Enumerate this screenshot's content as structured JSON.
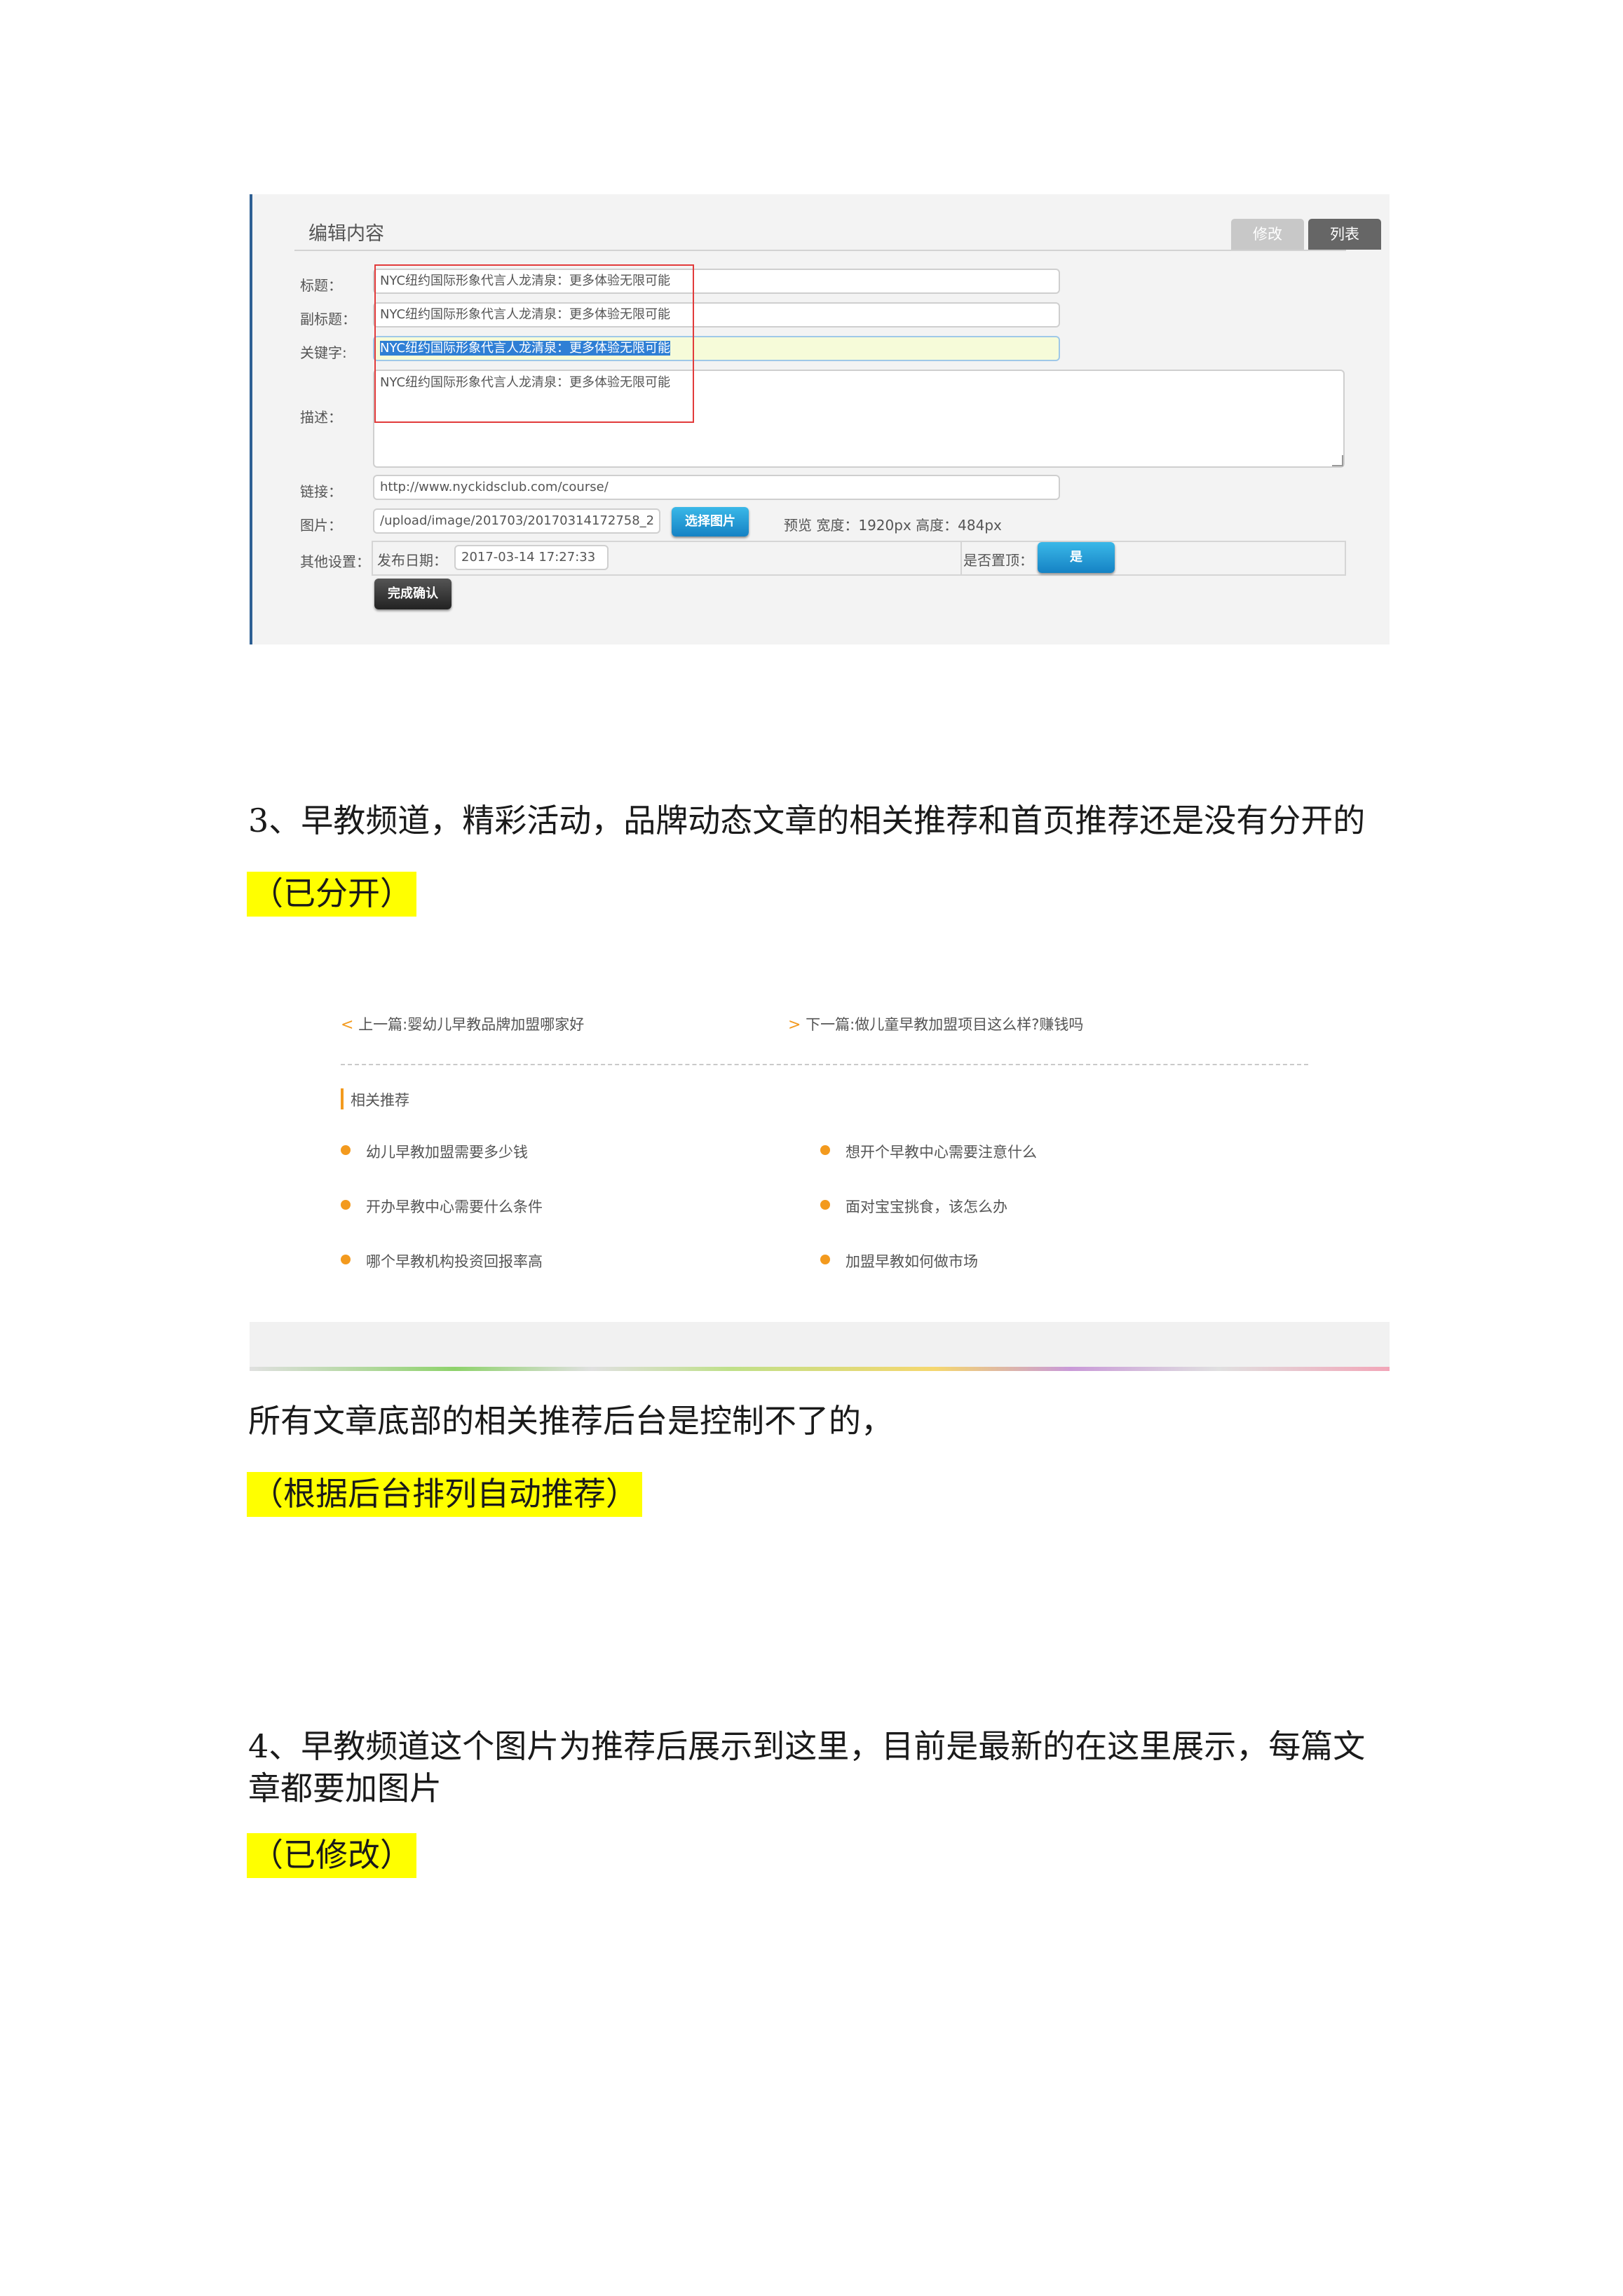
{
  "edit_form": {
    "title": "编辑内容",
    "tab_edit": "修改",
    "tab_list": "列表",
    "labels": {
      "title": "标题：",
      "subtitle": "副标题：",
      "keywords": "关键字:",
      "description": "描述：",
      "link": "链接：",
      "image": "图片：",
      "other": "其他设置：",
      "publish_date": "发布日期：",
      "pin_top": "是否置顶："
    },
    "values": {
      "title": "NYC纽约国际形象代言人龙清泉：更多体验无限可能",
      "subtitle": "NYC纽约国际形象代言人龙清泉：更多体验无限可能",
      "keywords": "NYC纽约国际形象代言人龙清泉：更多体验无限可能",
      "description": "NYC纽约国际形象代言人龙清泉：更多体验无限可能",
      "link": "http://www.nyckidsclub.com/course/",
      "image": "/upload/image/201703/20170314172758_2",
      "publish_date": "2017-03-14 17:27:33"
    },
    "choose_image_button": "选择图片",
    "preview_text": "预览 宽度：1920px 高度：484px",
    "pin_top_button": "是",
    "confirm_button": "完成确认"
  },
  "doc": {
    "item3": "3、早教频道，精彩活动，品牌动态文章的相关推荐和首页推荐还是没有分开的",
    "item3_status": "（已分开）",
    "note": "所有文章底部的相关推荐后台是控制不了的，",
    "note_status": "（根据后台排列自动推荐）",
    "item4_line1": "4、早教频道这个图片为推荐后展示到这里，目前是最新的在这里展示，每篇文",
    "item4_line2": "章都要加图片",
    "item4_status": "（已修改）"
  },
  "related": {
    "prev_chevron": "<",
    "prev": "上一篇:婴幼儿早教品牌加盟哪家好",
    "next_chevron": ">",
    "next": "下一篇:做儿童早教加盟项目这么样?赚钱吗",
    "heading": "相关推荐",
    "left_items": [
      "幼儿早教加盟需要多少钱",
      "开办早教中心需要什么条件",
      "哪个早教机构投资回报率高"
    ],
    "right_items": [
      "想开个早教中心需要注意什么",
      "面对宝宝挑食，该怎么办",
      "加盟早教如何做市场"
    ]
  },
  "colors": {
    "accent_orange": "#f39a1e",
    "highlight_yellow": "#ffff00",
    "button_blue": "#1c8fd0",
    "red_annotation": "#e23b3b"
  }
}
